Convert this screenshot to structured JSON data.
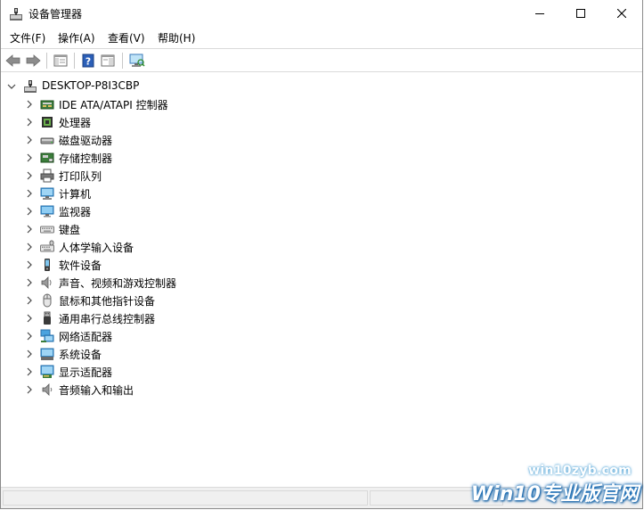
{
  "window": {
    "title": "设备管理器"
  },
  "menu": [
    "文件(F)",
    "操作(A)",
    "查看(V)",
    "帮助(H)"
  ],
  "tree": {
    "root": "DESKTOP-P8I3CBP",
    "items": [
      {
        "label": "IDE ATA/ATAPI 控制器",
        "icon": "ide-controller-icon"
      },
      {
        "label": "处理器",
        "icon": "processor-icon"
      },
      {
        "label": "磁盘驱动器",
        "icon": "disk-drive-icon"
      },
      {
        "label": "存储控制器",
        "icon": "storage-controller-icon"
      },
      {
        "label": "打印队列",
        "icon": "printer-icon"
      },
      {
        "label": "计算机",
        "icon": "computer-icon"
      },
      {
        "label": "监视器",
        "icon": "monitor-icon"
      },
      {
        "label": "键盘",
        "icon": "keyboard-icon"
      },
      {
        "label": "人体学输入设备",
        "icon": "hid-icon"
      },
      {
        "label": "软件设备",
        "icon": "software-device-icon"
      },
      {
        "label": "声音、视频和游戏控制器",
        "icon": "sound-icon"
      },
      {
        "label": "鼠标和其他指针设备",
        "icon": "mouse-icon"
      },
      {
        "label": "通用串行总线控制器",
        "icon": "usb-icon"
      },
      {
        "label": "网络适配器",
        "icon": "network-adapter-icon"
      },
      {
        "label": "系统设备",
        "icon": "system-device-icon"
      },
      {
        "label": "显示适配器",
        "icon": "display-adapter-icon"
      },
      {
        "label": "音频输入和输出",
        "icon": "audio-io-icon"
      }
    ]
  },
  "watermark": {
    "url": "win10zyb.com",
    "brand": "Win10专业版官网"
  }
}
